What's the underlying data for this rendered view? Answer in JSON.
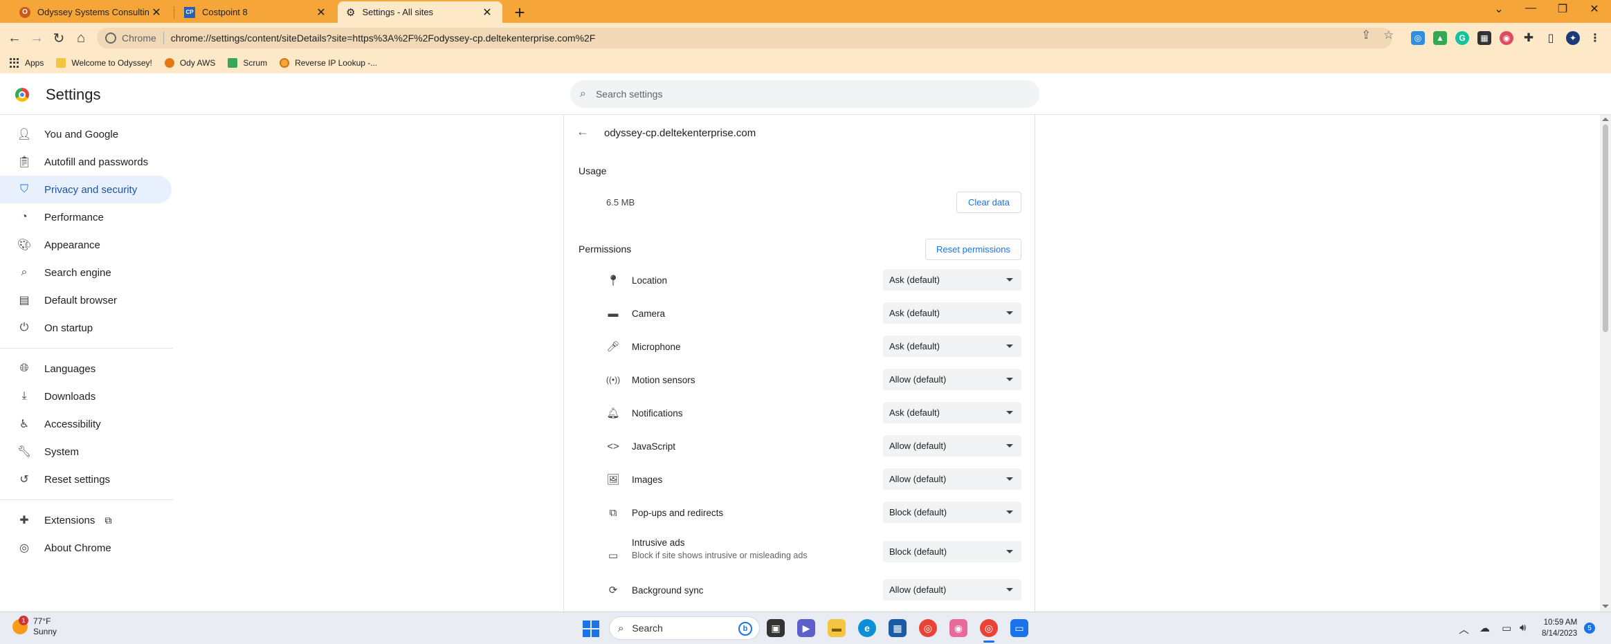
{
  "tabs": [
    {
      "title": "Odyssey Systems Consulting Gro",
      "favicon": "odyssey-favicon",
      "active": false
    },
    {
      "title": "Costpoint 8",
      "favicon": "costpoint-favicon",
      "active": false
    },
    {
      "title": "Settings - All sites",
      "favicon": "gear-icon",
      "active": true
    }
  ],
  "toolbar": {
    "scheme_label": "Chrome",
    "url": "chrome://settings/content/siteDetails?site=https%3A%2F%2Fodyssey-cp.deltekenterprise.com%2F"
  },
  "bookmarks": [
    {
      "label": "Apps",
      "icon": "apps-grid-icon"
    },
    {
      "label": "Welcome to Odyssey!",
      "icon": "folder-icon"
    },
    {
      "label": "Ody AWS",
      "icon": "aws-icon"
    },
    {
      "label": "Scrum",
      "icon": "scrum-icon"
    },
    {
      "label": "Reverse IP Lookup -...",
      "icon": "lookup-icon"
    }
  ],
  "settings": {
    "title": "Settings",
    "search_placeholder": "Search settings"
  },
  "sidebar": {
    "items": [
      {
        "label": "You and Google",
        "icon": "person-icon"
      },
      {
        "label": "Autofill and passwords",
        "icon": "clipboard-icon"
      },
      {
        "label": "Privacy and security",
        "icon": "shield-icon",
        "selected": true
      },
      {
        "label": "Performance",
        "icon": "speedometer-icon"
      },
      {
        "label": "Appearance",
        "icon": "palette-icon"
      },
      {
        "label": "Search engine",
        "icon": "search-icon"
      },
      {
        "label": "Default browser",
        "icon": "browser-icon"
      },
      {
        "label": "On startup",
        "icon": "power-icon"
      },
      {
        "label": "Languages",
        "icon": "globe-icon"
      },
      {
        "label": "Downloads",
        "icon": "download-icon"
      },
      {
        "label": "Accessibility",
        "icon": "accessibility-icon"
      },
      {
        "label": "System",
        "icon": "wrench-icon"
      },
      {
        "label": "Reset settings",
        "icon": "reset-icon"
      },
      {
        "label": "Extensions",
        "icon": "puzzle-icon"
      },
      {
        "label": "About Chrome",
        "icon": "chrome-icon"
      }
    ]
  },
  "site": {
    "name": "odyssey-cp.deltekenterprise.com",
    "usage_label": "Usage",
    "usage_value": "6.5 MB",
    "clear_data_label": "Clear data",
    "permissions_label": "Permissions",
    "reset_permissions_label": "Reset permissions",
    "permissions": [
      {
        "label": "Location",
        "value": "Ask (default)",
        "icon": "location-pin-icon"
      },
      {
        "label": "Camera",
        "value": "Ask (default)",
        "icon": "camera-icon"
      },
      {
        "label": "Microphone",
        "value": "Ask (default)",
        "icon": "microphone-icon"
      },
      {
        "label": "Motion sensors",
        "value": "Allow (default)",
        "icon": "motion-sensor-icon"
      },
      {
        "label": "Notifications",
        "value": "Ask (default)",
        "icon": "bell-icon"
      },
      {
        "label": "JavaScript",
        "value": "Allow (default)",
        "icon": "code-icon"
      },
      {
        "label": "Images",
        "value": "Allow (default)",
        "icon": "image-icon"
      },
      {
        "label": "Pop-ups and redirects",
        "value": "Block (default)",
        "icon": "popup-icon"
      },
      {
        "label": "Intrusive ads",
        "sublabel": "Block if site shows intrusive or misleading ads",
        "value": "Block (default)",
        "icon": "ads-icon"
      },
      {
        "label": "Background sync",
        "value": "Allow (default)",
        "icon": "sync-icon"
      }
    ]
  },
  "taskbar": {
    "weather_temp": "77°F",
    "weather_desc": "Sunny",
    "weather_badge": "1",
    "search_label": "Search",
    "time": "10:59 AM",
    "date": "8/14/2023",
    "notification_count": "5"
  },
  "colors": {
    "tabstrip": "#f6a539",
    "toolbar": "#fde8c8",
    "accent": "#1a73e8",
    "selected_nav_bg": "#e8f0fe"
  }
}
